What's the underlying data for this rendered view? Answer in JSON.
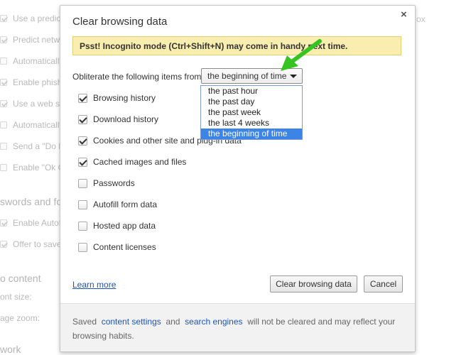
{
  "background": {
    "rows": [
      {
        "text": "Use a predict",
        "checked": true
      },
      {
        "text": "Predict netwo",
        "checked": true
      },
      {
        "text": "Automatically",
        "checked": false
      },
      {
        "text": "Enable phishi",
        "checked": true
      },
      {
        "text": "Use a web ser",
        "checked": true
      },
      {
        "text": "Automatically",
        "checked": false
      },
      {
        "text": "Send a \"Do N",
        "checked": false
      },
      {
        "text": "Enable \"Ok Go",
        "checked": false
      }
    ],
    "heading_passwords": "swords and for",
    "rows2": [
      {
        "text": "Enable Autofil",
        "checked": true
      },
      {
        "text": "Offer to save",
        "checked": true
      }
    ],
    "heading_content": "o content",
    "font_size": "ont size:",
    "page_zoom": "age zoom:",
    "heading_network": "work",
    "right_fragment": "ox"
  },
  "dialog": {
    "title": "Clear browsing data",
    "close_glyph": "×",
    "banner": "Psst! Incognito mode (Ctrl+Shift+N) may come in handy next time.",
    "obliterate_label": "Obliterate the following items from:",
    "select_value": "the beginning of time",
    "options": [
      "the past hour",
      "the past day",
      "the past week",
      "the last 4 weeks",
      "the beginning of time"
    ],
    "items": [
      {
        "label": "Browsing history",
        "checked": true
      },
      {
        "label": "Download history",
        "checked": true
      },
      {
        "label": "Cookies and other site and plug-in data",
        "checked": true
      },
      {
        "label": "Cached images and files",
        "checked": true
      },
      {
        "label": "Passwords",
        "checked": false
      },
      {
        "label": "Autofill form data",
        "checked": false
      },
      {
        "label": "Hosted app data",
        "checked": false
      },
      {
        "label": "Content licenses",
        "checked": false
      }
    ],
    "learn_more": "Learn more",
    "clear_button": "Clear browsing data",
    "cancel_button": "Cancel",
    "footer": {
      "pre": "Saved",
      "link1": "content settings",
      "mid": "and",
      "link2": "search engines",
      "post": "will not be cleared and may reflect your browsing habits."
    }
  },
  "annotation": {
    "arrow_color": "#35c422"
  }
}
